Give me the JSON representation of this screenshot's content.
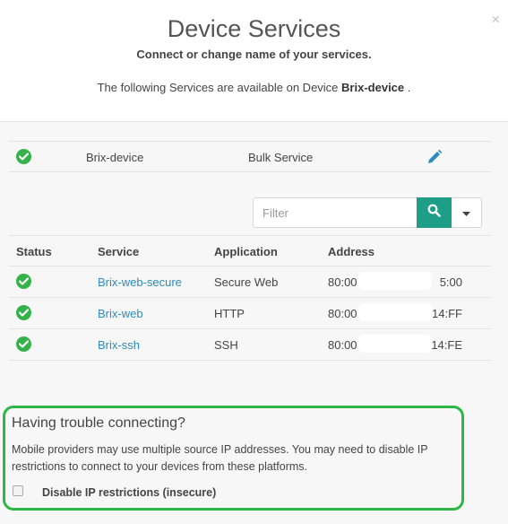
{
  "modal": {
    "title": "Device Services",
    "subtitle": "Connect or change name of your services.",
    "desc_prefix": "The following Services are available on Device",
    "desc_device": "Brix-device",
    "desc_suffix": ".",
    "close_label": "×"
  },
  "device": {
    "name": "Brix-device",
    "service": "Bulk Service",
    "status": "online",
    "edit_icon": "pencil-icon"
  },
  "filter": {
    "placeholder": "Filter",
    "value": "",
    "search_icon": "search-icon",
    "dropdown_icon": "caret-down-icon"
  },
  "services_table": {
    "columns": [
      "Status",
      "Service",
      "Application",
      "Address"
    ],
    "rows": [
      {
        "status": "online",
        "service": "Brix-web-secure",
        "application": "Secure Web",
        "address_start": "80:00",
        "address_end": "5:00"
      },
      {
        "status": "online",
        "service": "Brix-web",
        "application": "HTTP",
        "address_start": "80:00",
        "address_end": "14:FF"
      },
      {
        "status": "online",
        "service": "Brix-ssh",
        "application": "SSH",
        "address_start": "80:00",
        "address_end": "14:FE"
      }
    ]
  },
  "trouble": {
    "title": "Having trouble connecting?",
    "text": "Mobile providers may use multiple source IP addresses. You may need to disable IP restrictions to connect to your devices from these platforms.",
    "checkbox_label": "Disable IP restrictions (insecure)",
    "checkbox_checked": false
  },
  "colors": {
    "status_ok": "#35b34a",
    "accent_teal": "#1e9e86",
    "link": "#2a8bbd",
    "highlight_border": "#2db845"
  }
}
